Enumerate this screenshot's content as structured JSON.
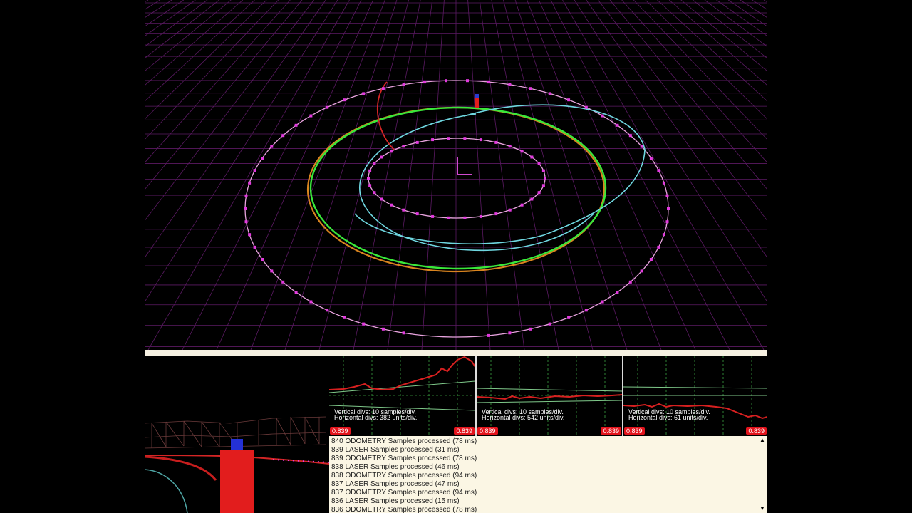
{
  "colors": {
    "grid": "#5b1a63",
    "trajectory_green": "#39e83a",
    "trajectory_orange": "#d9841f",
    "trajectory_cyan": "#6fd7e0",
    "trajectory_red": "#d42525",
    "waypoint_magenta": "#e33adf",
    "scope_trace_red": "#d82020",
    "scope_trace_green": "#7fc98a",
    "scope_grid": "#3aa040",
    "log_background": "#fbf6e4",
    "splitter": "#f6f1e2",
    "badge": "#e3141c"
  },
  "scene": {
    "robot_marker_icon": "robot-marker-icon",
    "origin_axes_icon": "origin-axes-icon"
  },
  "scopes": [
    {
      "info_line1": "Vertical divs: 10 samples/div.",
      "info_line2": "Horizontal divs: 382 units/div.",
      "badge_left": "0.839",
      "badge_right": "0.839"
    },
    {
      "info_line1": "Vertical divs: 10 samples/div.",
      "info_line2": "Horizontal divs: 542 units/div.",
      "badge_left": "0.839",
      "badge_right": "0.839"
    },
    {
      "info_line1": "Vertical divs: 10 samples/div.",
      "info_line2": "Horizontal divs: 61 units/div.",
      "badge_left": "0.839",
      "badge_right": "0.839"
    }
  ],
  "log": {
    "lines": [
      "840 ODOMETRY Samples processed (78 ms)",
      "839 LASER Samples processed (31 ms)",
      "839 ODOMETRY Samples processed (78 ms)",
      "838 LASER Samples processed (46 ms)",
      "838 ODOMETRY Samples processed (94 ms)",
      "837 LASER Samples processed (47 ms)",
      "837 ODOMETRY Samples processed (94 ms)",
      "836 LASER Samples processed (15 ms)",
      "836 ODOMETRY Samples processed (78 ms)"
    ],
    "scroll_up_icon": "▲",
    "scroll_down_icon": "▼"
  }
}
